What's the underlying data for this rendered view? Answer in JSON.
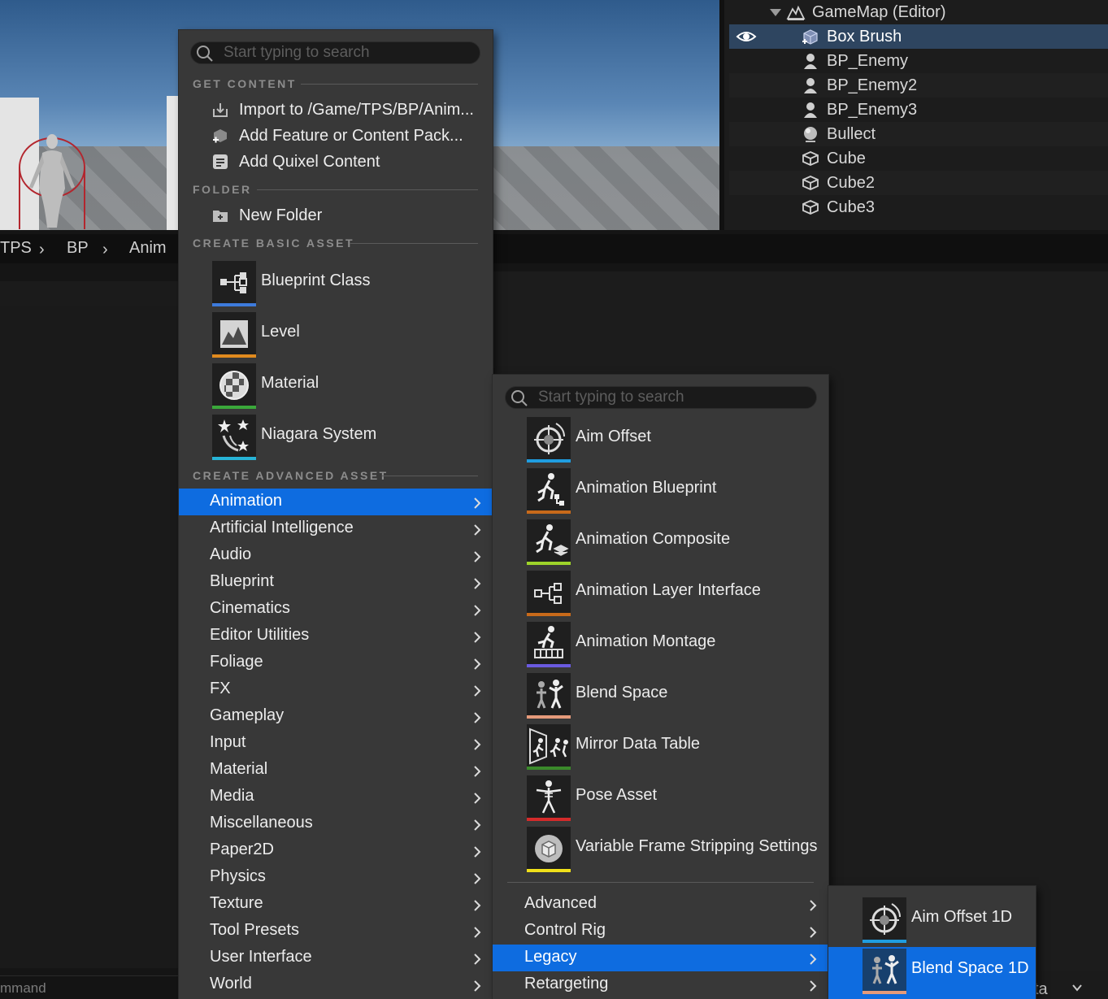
{
  "outliner": {
    "rows": [
      {
        "label": "GameMap (Editor)",
        "icon": "level-icon"
      },
      {
        "label": "Box Brush",
        "icon": "box-brush-icon",
        "selected": true
      },
      {
        "label": "BP_Enemy",
        "icon": "pawn-icon"
      },
      {
        "label": "BP_Enemy2",
        "icon": "pawn-icon"
      },
      {
        "label": "BP_Enemy3",
        "icon": "pawn-icon"
      },
      {
        "label": "Bullect",
        "icon": "sphere-actor-icon"
      },
      {
        "label": "Cube",
        "icon": "static-mesh-icon"
      },
      {
        "label": "Cube2",
        "icon": "static-mesh-icon"
      },
      {
        "label": "Cube3",
        "icon": "static-mesh-icon"
      }
    ]
  },
  "content_browser": {
    "breadcrumbs": [
      "TPS",
      "BP",
      "Anim"
    ],
    "command_placeholder": "mmand",
    "status_right": "ta"
  },
  "main_menu": {
    "search_placeholder": "Start typing to search",
    "sections": {
      "get_content": "GET CONTENT",
      "folder": "FOLDER",
      "basic": "CREATE BASIC ASSET",
      "advanced": "CREATE ADVANCED ASSET"
    },
    "get_content_items": [
      {
        "label": "Import to /Game/TPS/BP/Anim...",
        "icon": "import-icon"
      },
      {
        "label": "Add Feature or Content Pack...",
        "icon": "feature-pack-icon"
      },
      {
        "label": "Add Quixel Content",
        "icon": "quixel-icon"
      }
    ],
    "folder_items": [
      {
        "label": "New Folder",
        "icon": "new-folder-icon"
      }
    ],
    "basic_assets": [
      {
        "label": "Blueprint Class",
        "icon": "blueprint-class-icon",
        "color": "#3d7bdc"
      },
      {
        "label": "Level",
        "icon": "level-icon",
        "color": "#e08a1e"
      },
      {
        "label": "Material",
        "icon": "material-icon",
        "color": "#3aa83a"
      },
      {
        "label": "Niagara System",
        "icon": "niagara-icon",
        "color": "#27b3d6"
      }
    ],
    "categories": [
      "Animation",
      "Artificial Intelligence",
      "Audio",
      "Blueprint",
      "Cinematics",
      "Editor Utilities",
      "Foliage",
      "FX",
      "Gameplay",
      "Input",
      "Material",
      "Media",
      "Miscellaneous",
      "Paper2D",
      "Physics",
      "Texture",
      "Tool Presets",
      "User Interface",
      "World"
    ],
    "active_category": "Animation",
    "accent": "#0e6ce0"
  },
  "animation_menu": {
    "search_placeholder": "Start typing to search",
    "assets": [
      {
        "label": "Aim Offset",
        "icon": "aim-offset-icon",
        "color": "#1f9de0"
      },
      {
        "label": "Animation Blueprint",
        "icon": "animation-blueprint-icon",
        "color": "#c86a1a"
      },
      {
        "label": "Animation Composite",
        "icon": "animation-composite-icon",
        "color": "#9ed42a"
      },
      {
        "label": "Animation Layer Interface",
        "icon": "animation-layer-interface-icon",
        "color": "#c86a1a"
      },
      {
        "label": "Animation Montage",
        "icon": "animation-montage-icon",
        "color": "#6a5ae0"
      },
      {
        "label": "Blend Space",
        "icon": "blend-space-icon",
        "color": "#e59a7a"
      },
      {
        "label": "Mirror Data Table",
        "icon": "mirror-data-table-icon",
        "color": "#3a8a2a"
      },
      {
        "label": "Pose Asset",
        "icon": "pose-asset-icon",
        "color": "#d42a2a"
      },
      {
        "label": "Variable Frame Stripping Settings",
        "icon": "frame-stripping-icon",
        "color": "#f0e01a"
      }
    ],
    "submenus": [
      "Advanced",
      "Control Rig",
      "Legacy",
      "Retargeting"
    ],
    "active_submenu": "Legacy"
  },
  "legacy_menu": {
    "assets": [
      {
        "label": "Aim Offset 1D",
        "icon": "aim-offset-1d-icon",
        "color": "#1f9de0"
      },
      {
        "label": "Blend Space 1D",
        "icon": "blend-space-1d-icon",
        "color": "#e59a7a",
        "active": true
      }
    ]
  }
}
